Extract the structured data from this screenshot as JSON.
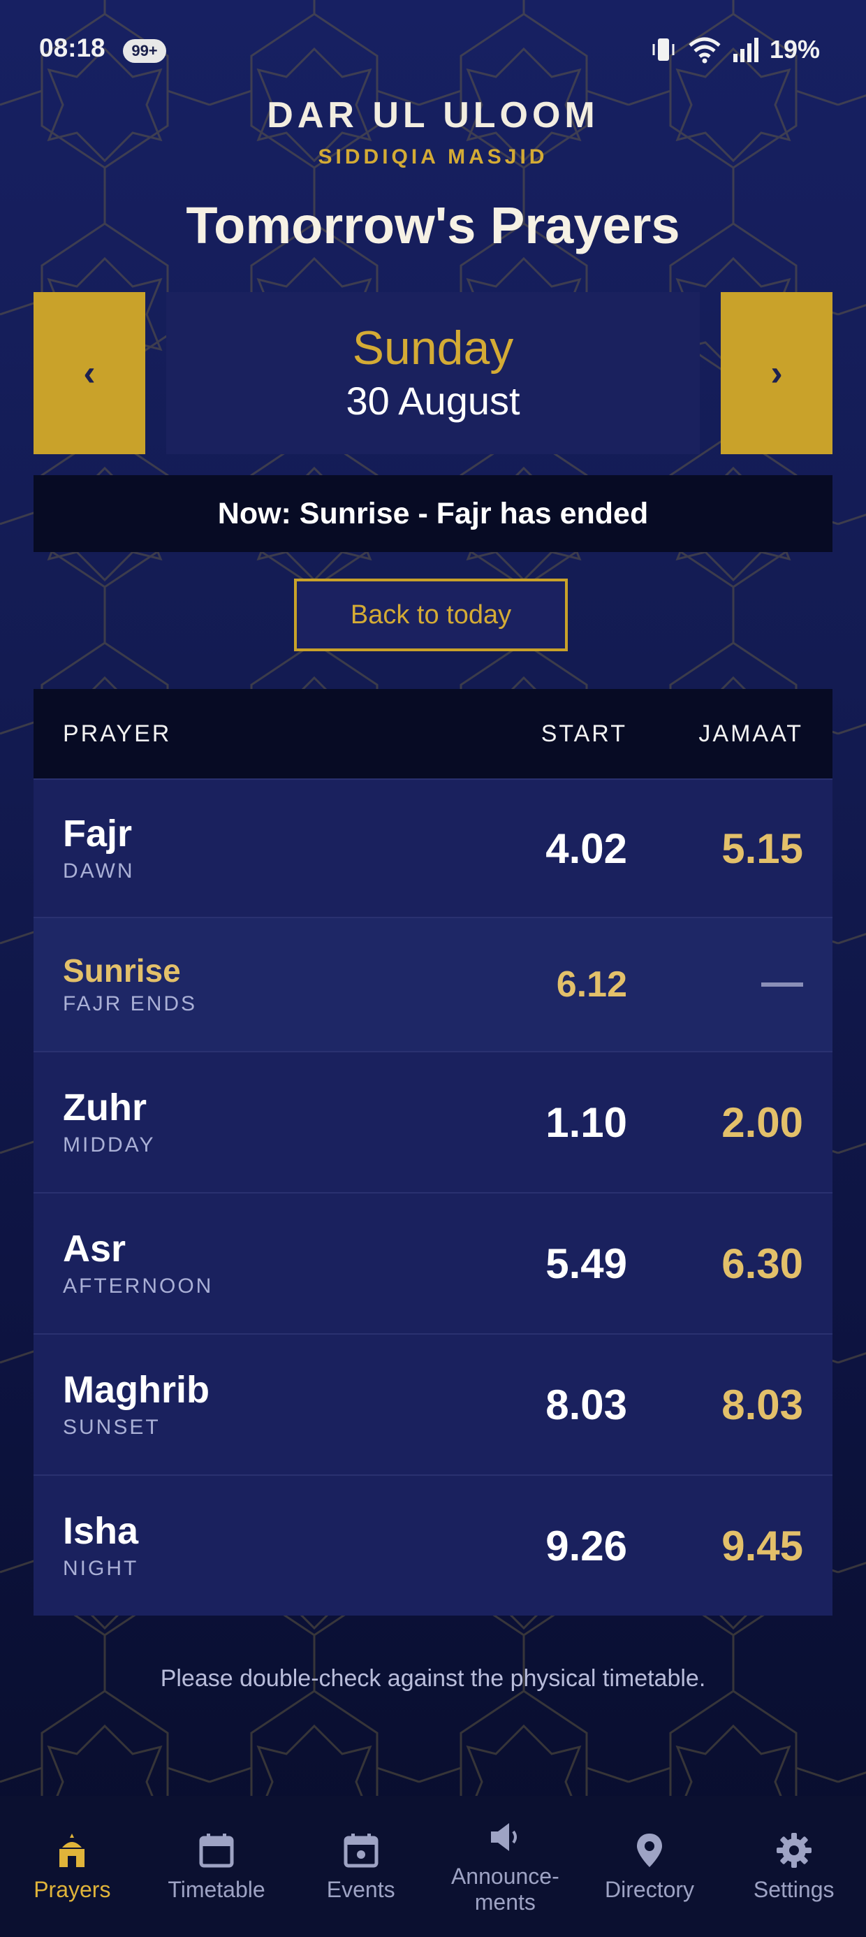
{
  "status_bar": {
    "time": "08:18",
    "notification_badge": "99+",
    "battery": "19%"
  },
  "header": {
    "brand_name": "DAR UL ULOOM",
    "brand_sub": "SIDDIQIA MASJID",
    "title": "Tomorrow's Prayers"
  },
  "date_nav": {
    "prev_label": "‹",
    "next_label": "›",
    "day": "Sunday",
    "date": "30 August"
  },
  "now_banner": "Now: Sunrise - Fajr has ended",
  "back_button": "Back to today",
  "table": {
    "headers": {
      "prayer": "PRAYER",
      "start": "START",
      "jamaat": "JAMAAT"
    },
    "rows": [
      {
        "name": "Fajr",
        "sub": "DAWN",
        "start": "4.02",
        "jamaat": "5.15"
      },
      {
        "name": "Sunrise",
        "sub": "FAJR ENDS",
        "start": "6.12",
        "jamaat": ""
      },
      {
        "name": "Zuhr",
        "sub": "MIDDAY",
        "start": "1.10",
        "jamaat": "2.00"
      },
      {
        "name": "Asr",
        "sub": "AFTERNOON",
        "start": "5.49",
        "jamaat": "6.30"
      },
      {
        "name": "Maghrib",
        "sub": "SUNSET",
        "start": "8.03",
        "jamaat": "8.03"
      },
      {
        "name": "Isha",
        "sub": "NIGHT",
        "start": "9.26",
        "jamaat": "9.45"
      }
    ]
  },
  "note": "Please double-check against the physical timetable.",
  "bottom_nav": [
    {
      "label": "Prayers",
      "icon": "mosque-icon",
      "active": true
    },
    {
      "label": "Timetable",
      "icon": "calendar-icon",
      "active": false
    },
    {
      "label": "Events",
      "icon": "event-icon",
      "active": false
    },
    {
      "label": "Announce-\nments",
      "icon": "megaphone-icon",
      "active": false
    },
    {
      "label": "Directory",
      "icon": "location-pin-icon",
      "active": false
    },
    {
      "label": "Settings",
      "icon": "gear-icon",
      "active": false
    }
  ],
  "colors": {
    "background": "#131b52",
    "accent_gold": "#c9a22a",
    "gold_text": "#e3c06a",
    "panel": "#1a215e",
    "dark_bar": "#070b24"
  }
}
